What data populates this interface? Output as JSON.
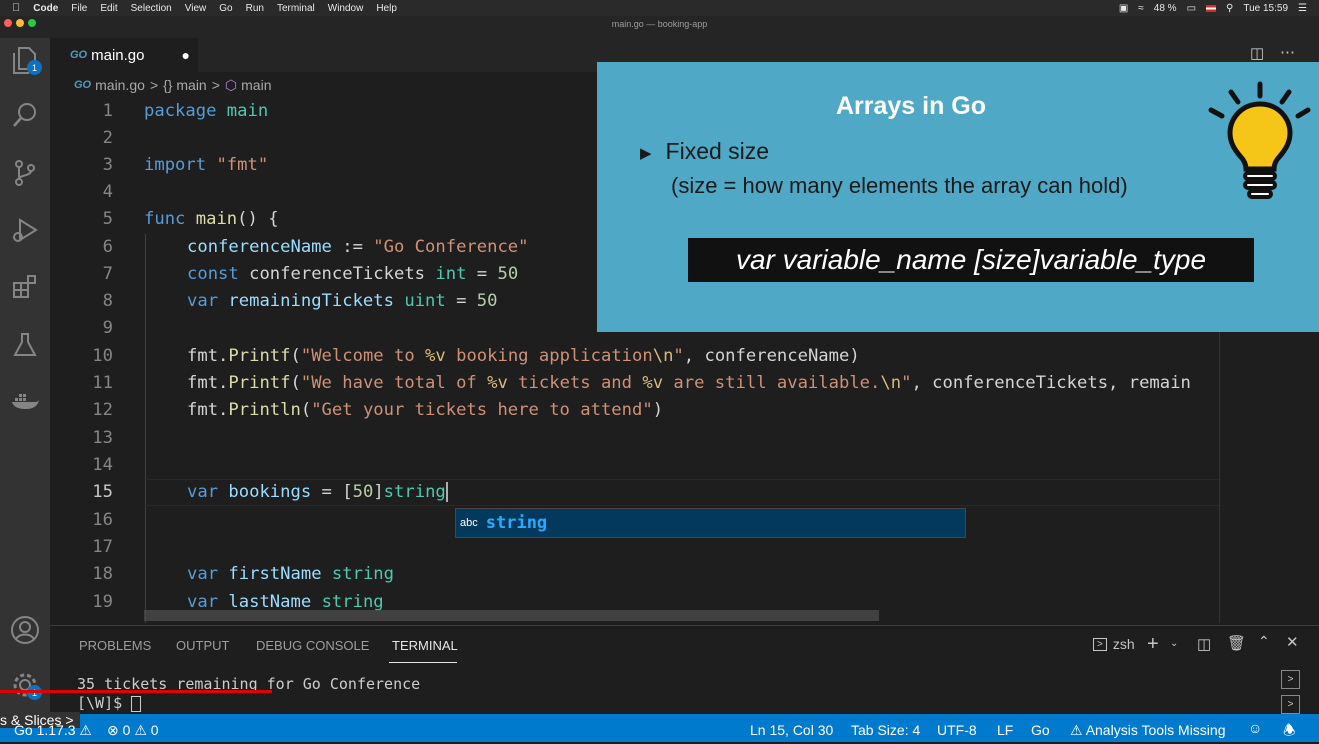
{
  "menubar": {
    "app": "Code",
    "items": [
      "File",
      "Edit",
      "Selection",
      "View",
      "Go",
      "Run",
      "Terminal",
      "Window",
      "Help"
    ],
    "battery": "48 %",
    "clock": "Tue 15:59"
  },
  "window": {
    "title": "main.go — booking-app"
  },
  "activity": {
    "explorer_badge": "1",
    "settings_badge": "1"
  },
  "tab": {
    "icon_label": "GO",
    "name": "main.go"
  },
  "breadcrumb": {
    "file": "main.go",
    "sep": ">",
    "scope1": "{} main",
    "scope2": "main"
  },
  "editor": {
    "lines": [
      {
        "n": "1"
      },
      {
        "n": "2"
      },
      {
        "n": "3"
      },
      {
        "n": "4"
      },
      {
        "n": "5"
      },
      {
        "n": "6"
      },
      {
        "n": "7"
      },
      {
        "n": "8"
      },
      {
        "n": "9"
      },
      {
        "n": "10"
      },
      {
        "n": "11"
      },
      {
        "n": "12"
      },
      {
        "n": "13"
      },
      {
        "n": "14"
      },
      {
        "n": "15"
      },
      {
        "n": "16"
      },
      {
        "n": "17"
      },
      {
        "n": "18"
      },
      {
        "n": "19"
      }
    ],
    "tok": {
      "package": "package",
      "main": "main",
      "import": "import",
      "fmt_str": "\"fmt\"",
      "func": "func",
      "main_fn": "main",
      "main_rest": "() {",
      "confName": "conferenceName",
      "assign": " := ",
      "goConf": "\"Go Conference\"",
      "const": "const",
      "confTickets": "conferenceTickets",
      "int": "int",
      "eq": " = ",
      "n50": "50",
      "var": "var",
      "remTickets": "remainingTickets",
      "uint": "uint",
      "fmt": "fmt.",
      "printf": "Printf",
      "println": "Println",
      "l10_s1": "\"Welcome to ",
      "fmtv": "%v",
      "l10_s2": " booking application",
      "nl": "\\n",
      "q": "\"",
      "l10_end": ", conferenceName)",
      "l11_s1": "\"We have total of ",
      "l11_s2": " tickets and ",
      "l11_s3": " are still available.",
      "l11_end": ", conferenceTickets, remain",
      "l12_s": "\"Get your tickets here to attend\"",
      "rparen": ")",
      "bookings": "bookings",
      "lbr": "[",
      "rbr": "]",
      "string": "string",
      "firstName": "firstName",
      "lastName": "lastName"
    }
  },
  "slide": {
    "title": "Arrays in Go",
    "bullet": "Fixed size",
    "sub": "(size = how many elements the array can hold)",
    "code": "var variable_name [size]variable_type"
  },
  "suggest": {
    "kind": "abc",
    "label": "string"
  },
  "panel": {
    "tabs": [
      "PROBLEMS",
      "OUTPUT",
      "DEBUG CONSOLE",
      "TERMINAL"
    ],
    "shell": "zsh",
    "term_line1": "35 tickets remaining for Go Conference",
    "term_line2": "[\\W]$ "
  },
  "status": {
    "left_overlay": "s & Slices",
    "go_version": "Go 1.17.3",
    "errors": "0",
    "warnings": "0",
    "position": "Ln 15, Col 30",
    "tab_size": "Tab Size: 4",
    "encoding": "UTF-8",
    "eol": "LF",
    "language": "Go",
    "analysis": "Analysis Tools Missing"
  },
  "colors": {
    "accent": "#007acc",
    "slide_bg": "#4fa8c6",
    "bulb": "#f5c518"
  }
}
